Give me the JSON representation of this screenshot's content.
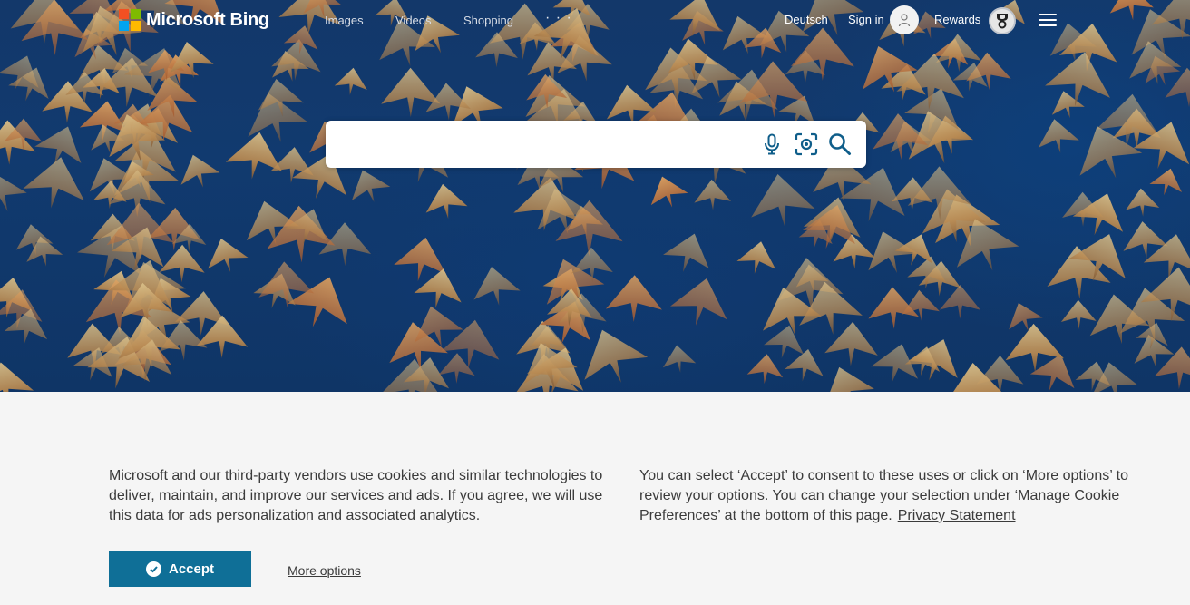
{
  "header": {
    "brand": "Microsoft Bing",
    "nav": [
      "Images",
      "Videos",
      "Shopping",
      "· · ·"
    ],
    "language": "Deutsch",
    "sign_in": "Sign in",
    "rewards": "Rewards",
    "icons": {
      "avatar": "user-avatar-icon",
      "rewards": "trophy-medal-icon",
      "menu": "hamburger-menu-icon"
    },
    "logo_colors": [
      "#f25022",
      "#7fba00",
      "#00a4ef",
      "#ffb900"
    ]
  },
  "search": {
    "value": "",
    "placeholder": "",
    "icons": [
      "microphone-icon",
      "visual-search-icon",
      "search-icon"
    ],
    "icon_color": "#0f5e8a"
  },
  "cookie_banner": {
    "left_text": "Microsoft and our third-party vendors use cookies and similar technologies to deliver, maintain, and improve our services and ads. If you agree, we will use this data for ads personalization and associated analytics.",
    "right_text": "You can select ‘Accept’ to consent to these uses or click on ‘More options’ to review your options.  You can change your selection under ‘Manage Cookie Preferences’ at the bottom of this page.",
    "privacy_link": "Privacy Statement",
    "accept_label": "Accept",
    "more_options_label": "More options",
    "accept_color": "#0f6f97"
  }
}
